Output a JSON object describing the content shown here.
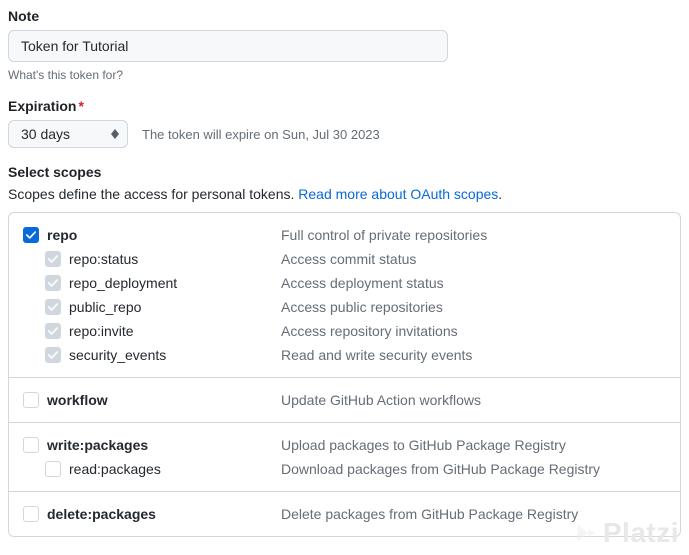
{
  "note": {
    "label": "Note",
    "value": "Token for Tutorial",
    "hint": "What's this token for?"
  },
  "expiration": {
    "label": "Expiration",
    "required_marker": "*",
    "selected": "30 days",
    "note": "The token will expire on Sun, Jul 30 2023"
  },
  "scopes": {
    "heading": "Select scopes",
    "description_prefix": "Scopes define the access for personal tokens. ",
    "description_link": "Read more about OAuth scopes",
    "description_suffix": "."
  },
  "scope_groups": [
    {
      "parent": {
        "name": "repo",
        "desc": "Full control of private repositories",
        "state": "checked",
        "bold": true
      },
      "children": [
        {
          "name": "repo:status",
          "desc": "Access commit status",
          "state": "indet"
        },
        {
          "name": "repo_deployment",
          "desc": "Access deployment status",
          "state": "indet"
        },
        {
          "name": "public_repo",
          "desc": "Access public repositories",
          "state": "indet"
        },
        {
          "name": "repo:invite",
          "desc": "Access repository invitations",
          "state": "indet"
        },
        {
          "name": "security_events",
          "desc": "Read and write security events",
          "state": "indet"
        }
      ]
    },
    {
      "parent": {
        "name": "workflow",
        "desc": "Update GitHub Action workflows",
        "state": "unchecked",
        "bold": true
      },
      "children": []
    },
    {
      "parent": {
        "name": "write:packages",
        "desc": "Upload packages to GitHub Package Registry",
        "state": "unchecked",
        "bold": true
      },
      "children": [
        {
          "name": "read:packages",
          "desc": "Download packages from GitHub Package Registry",
          "state": "unchecked"
        }
      ]
    },
    {
      "parent": {
        "name": "delete:packages",
        "desc": "Delete packages from GitHub Package Registry",
        "state": "unchecked",
        "bold": true
      },
      "children": []
    }
  ],
  "watermark": "Platzi"
}
